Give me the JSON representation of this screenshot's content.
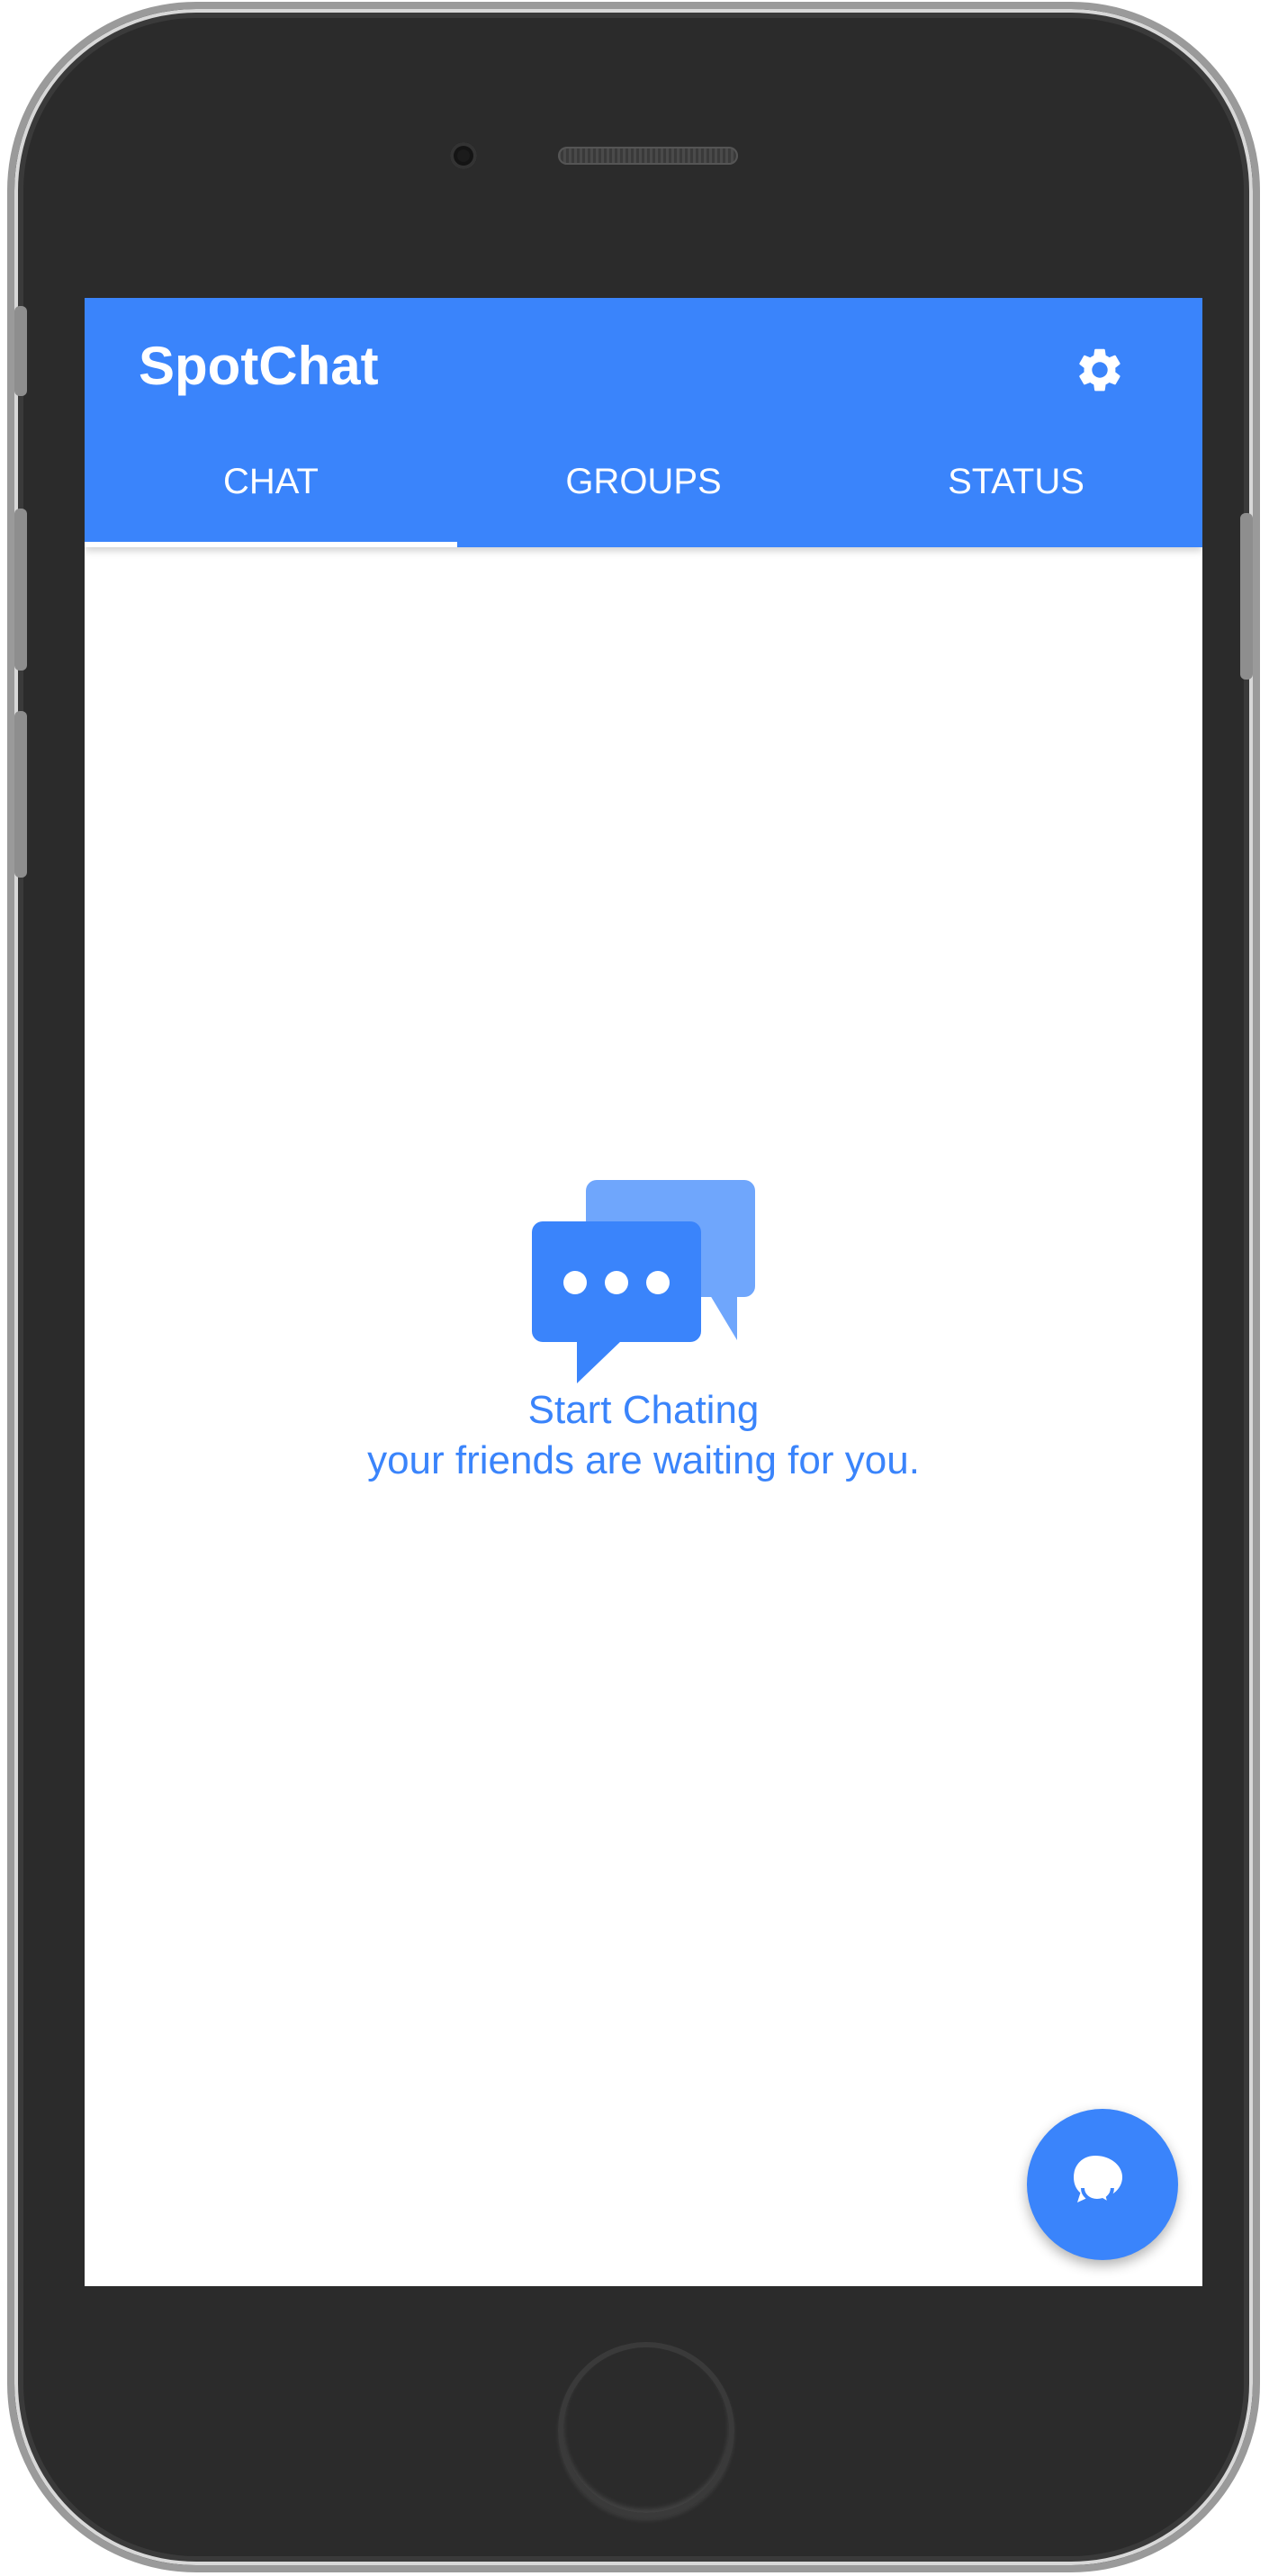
{
  "app": {
    "title": "SpotChat",
    "accent_color": "#3a84fb"
  },
  "header": {
    "settings_icon": "gear-icon"
  },
  "tabs": [
    {
      "label": "CHAT",
      "active": true
    },
    {
      "label": "GROUPS",
      "active": false
    },
    {
      "label": "STATUS",
      "active": false
    }
  ],
  "empty_state": {
    "icon": "chat-bubbles-icon",
    "title": "Start Chating",
    "subtitle": "your friends are waiting for you."
  },
  "fab": {
    "icon": "new-chat-icon"
  }
}
